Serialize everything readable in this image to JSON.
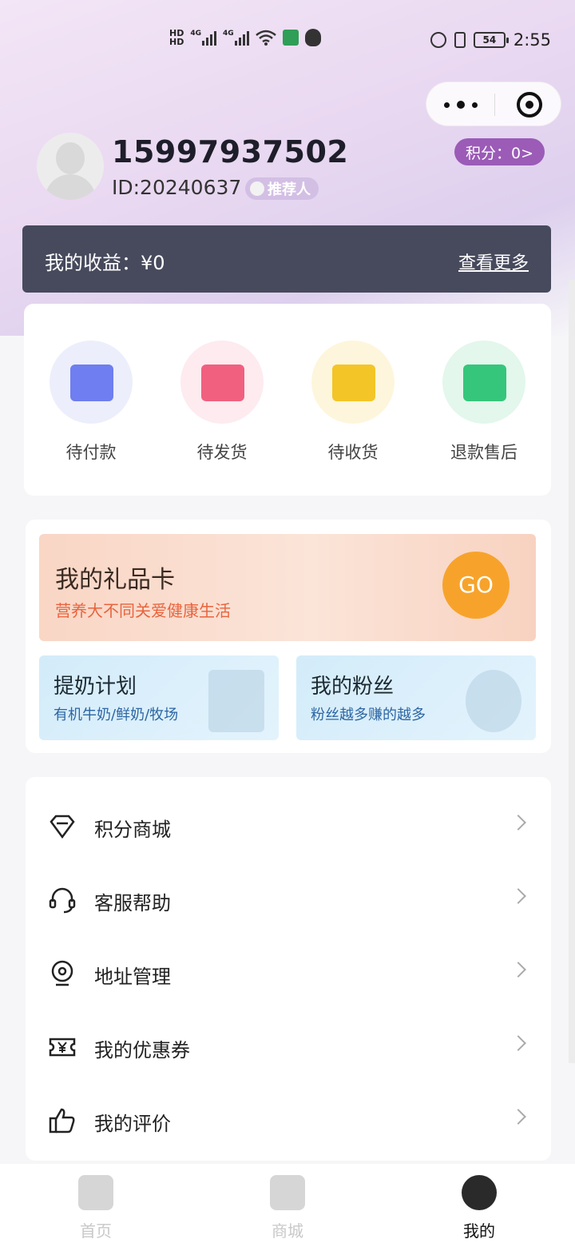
{
  "status_bar": {
    "hd1": "HD",
    "hd2": "HD",
    "net1": "4G",
    "net2": "4G",
    "battery": "54",
    "time": "2:55",
    "icons": [
      "signal-icon",
      "wifi-icon",
      "app-icon",
      "qq-icon",
      "alarm-icon",
      "vibrate-icon",
      "battery-icon"
    ]
  },
  "capsule": {
    "more_icon": "more-dots-icon",
    "close_icon": "target-close-icon"
  },
  "profile": {
    "phone": "15997937502",
    "id": "ID:20240637",
    "referrer_badge": "推荐人",
    "points": "积分：0>"
  },
  "earnings": {
    "label": "我的收益：¥0",
    "more": "查看更多"
  },
  "orders": [
    {
      "label": "待付款",
      "icon": "wallet-icon",
      "color": "#6f7ef0",
      "bg": "#eceefb"
    },
    {
      "label": "待发货",
      "icon": "box-icon",
      "color": "#f1607f",
      "bg": "#fdebf0"
    },
    {
      "label": "待收货",
      "icon": "package-icon",
      "color": "#f4c527",
      "bg": "#fdf6dc"
    },
    {
      "label": "退款售后",
      "icon": "return-icon",
      "color": "#35c67c",
      "bg": "#e3f7ec"
    }
  ],
  "gift_card": {
    "title": "我的礼品卡",
    "subtitle": "营养大不同关爱健康生活",
    "go": "GO"
  },
  "milk_plan": {
    "title": "提奶计划",
    "subtitle": "有机牛奶/鲜奶/牧场"
  },
  "fans": {
    "title": "我的粉丝",
    "subtitle": "粉丝越多赚的越多"
  },
  "menu": [
    {
      "label": "积分商城",
      "icon": "diamond-icon"
    },
    {
      "label": "客服帮助",
      "icon": "headset-icon"
    },
    {
      "label": "地址管理",
      "icon": "location-icon"
    },
    {
      "label": "我的优惠券",
      "icon": "coupon-icon"
    },
    {
      "label": "我的评价",
      "icon": "thumbs-up-icon"
    }
  ],
  "tabbar": [
    {
      "label": "首页",
      "icon": "home-icon"
    },
    {
      "label": "商城",
      "icon": "shop-icon"
    },
    {
      "label": "我的",
      "icon": "profile-icon"
    }
  ]
}
